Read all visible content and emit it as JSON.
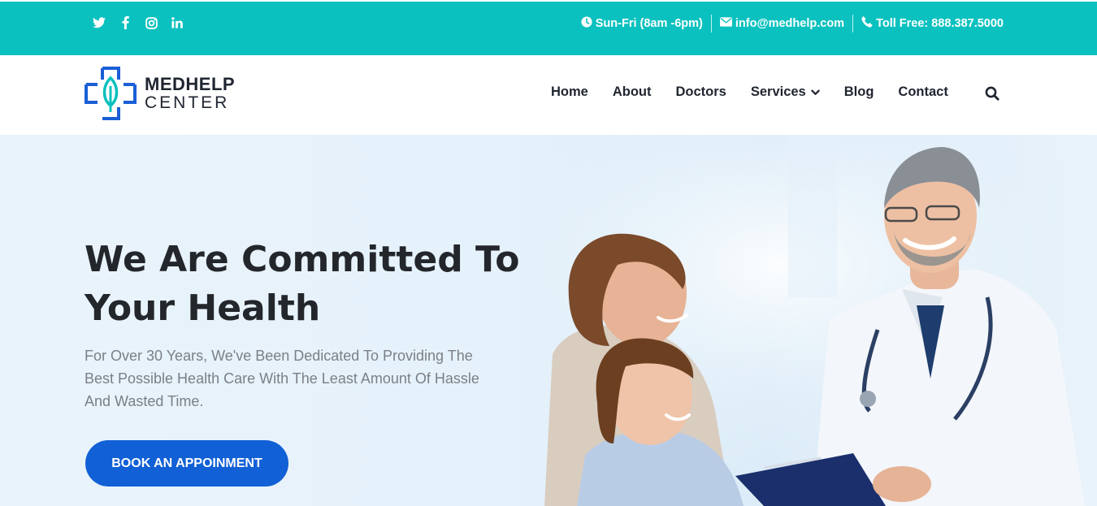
{
  "topbar": {
    "social_icons": [
      "twitter-icon",
      "facebook-icon",
      "instagram-icon",
      "linkedin-icon"
    ],
    "hours": "Sun-Fri (8am -6pm)",
    "email": "info@medhelp.com",
    "phone": "Toll Free: 888.387.5000",
    "background_color": "#0bc1bf"
  },
  "logo": {
    "line1": "MEDHELP",
    "line2": "CENTER",
    "icon": "medical-cross-leaf-icon"
  },
  "nav": {
    "items": [
      {
        "label": "Home"
      },
      {
        "label": "About"
      },
      {
        "label": "Doctors"
      },
      {
        "label": "Services",
        "dropdown": true
      },
      {
        "label": "Blog"
      },
      {
        "label": "Contact"
      }
    ],
    "search_icon": "search-icon"
  },
  "hero": {
    "title": "We Are Committed To Your Health",
    "subtitle": "For Over 30 Years, We've Been Dedicated To Providing The Best Possible Health Care With The Least Amount Of Hassle And Wasted Time.",
    "cta_label": "BOOK AN APPOINMENT",
    "cta_color": "#1160d5",
    "background_color": "#e8f3fb"
  }
}
